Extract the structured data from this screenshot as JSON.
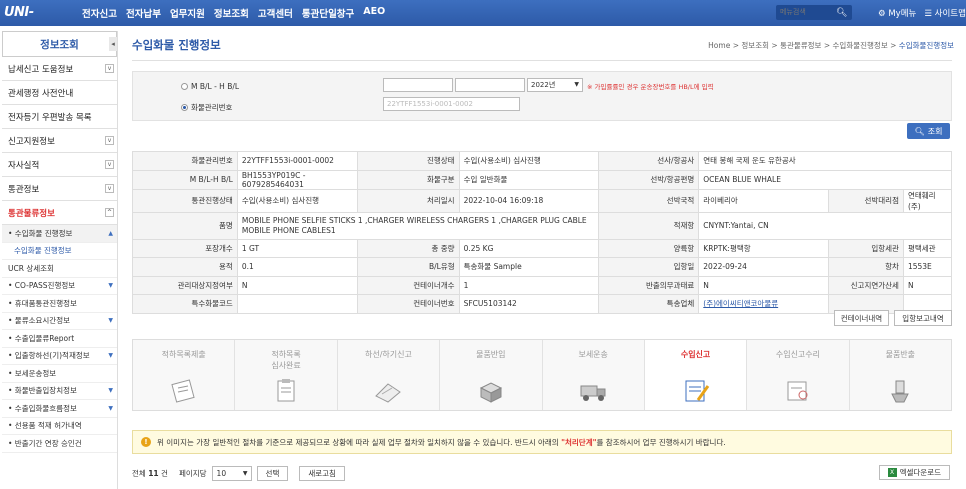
{
  "header": {
    "logo": "UNI-PASS",
    "nav": [
      "전자신고",
      "전자납부",
      "업무지원",
      "정보조회",
      "고객센터",
      "통관단일창구",
      "AEO"
    ],
    "search_placeholder": "메뉴검색",
    "mymenu": "My메뉴",
    "sitemap": "사이트맵"
  },
  "sidebar": {
    "title": "정보조회",
    "items": [
      {
        "label": "납세신고 도움정보",
        "toggle": "v"
      },
      {
        "label": "관세행정 사전안내",
        "toggle": ""
      },
      {
        "label": "전자등기 우편발송 목록",
        "toggle": ""
      },
      {
        "label": "신고지원정보",
        "toggle": "v"
      },
      {
        "label": "자사실적",
        "toggle": "v"
      },
      {
        "label": "통관정보",
        "toggle": "v"
      },
      {
        "label": "통관물류정보",
        "toggle": "^"
      }
    ],
    "sub": [
      {
        "label": "• 수입화물 진행정보",
        "toggle": "▲",
        "kind": "sel"
      },
      {
        "label": "수입화물 진행정보",
        "toggle": "",
        "kind": "cur"
      },
      {
        "label": "UCR 상세조회",
        "toggle": "",
        "kind": "plain"
      },
      {
        "label": "• CO-PASS진행정보",
        "toggle": "▼",
        "kind": "plain"
      },
      {
        "label": "• 휴대품통관진행정보",
        "toggle": "",
        "kind": "plain"
      },
      {
        "label": "• 물류소요시간정보",
        "toggle": "▼",
        "kind": "plain"
      },
      {
        "label": "• 수출입물류Report",
        "toggle": "",
        "kind": "plain"
      },
      {
        "label": "• 입출항하선(기)적재정보",
        "toggle": "▼",
        "kind": "plain"
      },
      {
        "label": "• 보세운송정보",
        "toggle": "",
        "kind": "plain"
      },
      {
        "label": "• 화물반출입장치정보",
        "toggle": "▼",
        "kind": "plain"
      },
      {
        "label": "• 수출입화물흐름정보",
        "toggle": "▼",
        "kind": "plain"
      },
      {
        "label": "• 선용품 적재 허가내역",
        "toggle": "",
        "kind": "plain"
      },
      {
        "label": "• 반출기간 연장 승인건",
        "toggle": "",
        "kind": "plain"
      }
    ]
  },
  "main": {
    "title": "수입화물 진행정보",
    "breadcrumb": [
      "Home",
      "정보조회",
      "통관물류정보",
      "수입화물진행정보",
      "수입화물진행정보"
    ],
    "search": {
      "radio_bl": "M B/L - H B/L",
      "radio_cargo": "화물관리번호",
      "year": "2022년",
      "note": "※ 가입률률인 경우 운송장번호를 HB/L에 입력",
      "cargo_value": "22YTFF1553i-0001-0002",
      "button": "조회"
    },
    "rows": [
      [
        "화물관리번호",
        "22YTFF1553i-0001-0002",
        "진행상태",
        "수입(사용소비) 심사진행",
        "선사/항공사",
        "연태 봉해 국제 운도 유한공사",
        "",
        ""
      ],
      [
        "M B/L-H B/L",
        "BH1553YP019C - 6079285464031",
        "화물구분",
        "수입 일반화물",
        "선박/항공편명",
        "OCEAN BLUE WHALE",
        "",
        ""
      ],
      [
        "통관진행상태",
        "수입(사용소비) 심사진행",
        "처리일시",
        "2022-10-04 16:09:18",
        "선박국적",
        "라이베리아",
        "선박대리점",
        "연태훼리(주)"
      ],
      [
        "품명",
        "MOBILE PHONE SELFIE STICKS 1 ,CHARGER WIRELESS CHARGERS 1 ,CHARGER PLUG CABLE MOBILE PHONE CABLES1",
        "",
        "",
        "적재항",
        "CNYNT:Yantai, CN",
        "",
        ""
      ],
      [
        "포장개수",
        "1 GT",
        "총 중량",
        "0.25 KG",
        "양륙항",
        "KRPTK:평택항",
        "입항세관",
        "평택세관"
      ],
      [
        "용적",
        "0.1",
        "B/L유형",
        "특송화물 Sample",
        "입항일",
        "2022-09-24",
        "항차",
        "1553E"
      ],
      [
        "관리대상지정여부",
        "N",
        "컨테이너개수",
        "1",
        "반출의무과태료",
        "N",
        "신고지연가산세",
        "N"
      ],
      [
        "특수화물코드",
        "",
        "컨테이너번호",
        "SFCU5103142",
        "특송업체",
        "(주)에이씨티앤코아물류",
        "",
        ""
      ]
    ],
    "btn_container": "컨테이너내역",
    "btn_report": "입항보고내역",
    "steps": [
      {
        "label": "적하목록제출",
        "active": false,
        "icon": "document-icon"
      },
      {
        "label": "적하목록\n심사완료",
        "active": false,
        "icon": "clipboard-icon"
      },
      {
        "label": "하선/하기신고",
        "active": false,
        "icon": "folder-icon"
      },
      {
        "label": "물품반입",
        "active": false,
        "icon": "box-icon"
      },
      {
        "label": "보세운송",
        "active": false,
        "icon": "truck-icon"
      },
      {
        "label": "수입신고",
        "active": true,
        "icon": "report-icon"
      },
      {
        "label": "수입신고수리",
        "active": false,
        "icon": "stamp-icon"
      },
      {
        "label": "물품반출",
        "active": false,
        "icon": "release-icon"
      }
    ],
    "warning": {
      "pre": "위 이미지는 가장 일반적인 절차를 기준으로 제공되므로 상황에 따라 실제 업무 절차와 일치하지 않을 수 있습니다. 반드시 아래의 ",
      "highlight": "\"처리단계\"",
      "post": "를 참조하시어 업무 진행하시기 바랍니다."
    },
    "footer": {
      "total_label": "전체",
      "total": "11",
      "unit": "건",
      "per_page_label": "페이지당",
      "per_page": "10",
      "select": "선택",
      "refresh": "새로고침",
      "excel": "엑셀다운로드"
    }
  },
  "colors": {
    "brand": "#2d5aa8",
    "alert": "#dd3333"
  }
}
